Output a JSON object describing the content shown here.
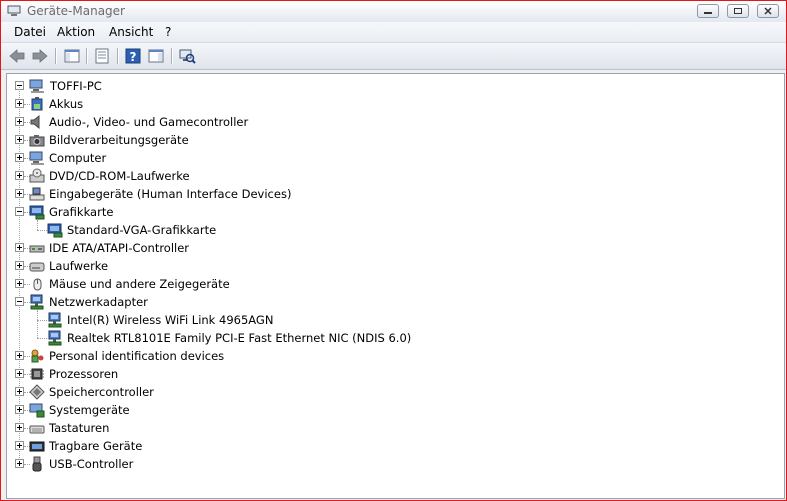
{
  "window": {
    "title": "Geräte-Manager"
  },
  "menu": [
    "Datei",
    "Aktion",
    "Ansicht",
    "?"
  ],
  "tree": {
    "root": "TOFFI-PC",
    "items": [
      {
        "label": "Akkus",
        "icon": "battery-icon",
        "expanded": false
      },
      {
        "label": "Audio-, Video- und Gamecontroller",
        "icon": "speaker-icon",
        "expanded": false
      },
      {
        "label": "Bildverarbeitungsgeräte",
        "icon": "camera-icon",
        "expanded": false
      },
      {
        "label": "Computer",
        "icon": "computer-icon",
        "expanded": false
      },
      {
        "label": "DVD/CD-ROM-Laufwerke",
        "icon": "optical-drive-icon",
        "expanded": false
      },
      {
        "label": "Eingabegeräte (Human Interface Devices)",
        "icon": "hid-icon",
        "expanded": false
      },
      {
        "label": "Grafikkarte",
        "icon": "display-adapter-icon",
        "expanded": true
      },
      {
        "label": "Standard-VGA-Grafikkarte",
        "icon": "display-adapter-icon",
        "child": true
      },
      {
        "label": "IDE ATA/ATAPI-Controller",
        "icon": "ide-controller-icon",
        "expanded": false
      },
      {
        "label": "Laufwerke",
        "icon": "disk-drive-icon",
        "expanded": false
      },
      {
        "label": "Mäuse und andere Zeigegeräte",
        "icon": "mouse-icon",
        "expanded": false
      },
      {
        "label": "Netzwerkadapter",
        "icon": "network-adapter-icon",
        "expanded": true
      },
      {
        "label": "Intel(R) Wireless WiFi Link 4965AGN",
        "icon": "network-adapter-icon",
        "child": true
      },
      {
        "label": "Realtek RTL8101E Family PCI-E Fast Ethernet NIC (NDIS 6.0)",
        "icon": "network-adapter-icon",
        "child": true
      },
      {
        "label": "Personal identification devices",
        "icon": "identification-icon",
        "expanded": false
      },
      {
        "label": "Prozessoren",
        "icon": "processor-icon",
        "expanded": false
      },
      {
        "label": "Speichercontroller",
        "icon": "storage-controller-icon",
        "expanded": false
      },
      {
        "label": "Systemgeräte",
        "icon": "system-device-icon",
        "expanded": false
      },
      {
        "label": "Tastaturen",
        "icon": "keyboard-icon",
        "expanded": false
      },
      {
        "label": "Tragbare Geräte",
        "icon": "portable-device-icon",
        "expanded": false
      },
      {
        "label": "USB-Controller",
        "icon": "usb-icon",
        "expanded": false
      }
    ]
  },
  "colors": {
    "accent": "#2b5fb4",
    "window_border": "#e21818"
  }
}
